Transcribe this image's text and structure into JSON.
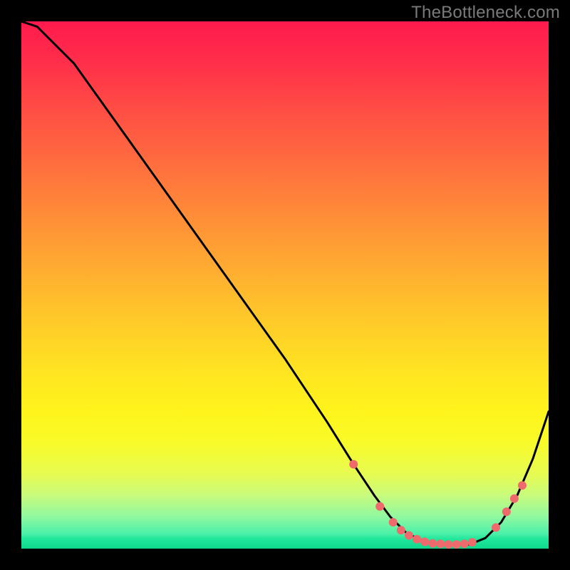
{
  "watermark": "TheBottleneck.com",
  "chart_data": {
    "type": "line",
    "title": "",
    "xlabel": "",
    "ylabel": "",
    "xlim": [
      0,
      100
    ],
    "ylim": [
      0,
      100
    ],
    "series": [
      {
        "name": "bottleneck-curve",
        "x": [
          0,
          3,
          10,
          20,
          30,
          40,
          50,
          58,
          63,
          67,
          70,
          73,
          76,
          79,
          82,
          85,
          88,
          91,
          94,
          97,
          100
        ],
        "y": [
          100,
          99,
          92,
          78,
          64,
          50,
          36,
          24,
          16,
          10,
          6,
          3,
          1.5,
          0.8,
          0.7,
          0.8,
          2,
          5,
          10,
          17,
          26
        ]
      }
    ],
    "markers": {
      "name": "highlight-points",
      "color": "#ef6a6d",
      "points": [
        {
          "x": 63,
          "y": 16
        },
        {
          "x": 68,
          "y": 8
        },
        {
          "x": 70.5,
          "y": 5
        },
        {
          "x": 72,
          "y": 3.5
        },
        {
          "x": 73.5,
          "y": 2.5
        },
        {
          "x": 75,
          "y": 1.8
        },
        {
          "x": 76.5,
          "y": 1.3
        },
        {
          "x": 78,
          "y": 1.0
        },
        {
          "x": 79.5,
          "y": 0.9
        },
        {
          "x": 81,
          "y": 0.8
        },
        {
          "x": 82.5,
          "y": 0.8
        },
        {
          "x": 84,
          "y": 0.9
        },
        {
          "x": 85.5,
          "y": 1.2
        },
        {
          "x": 90,
          "y": 4
        },
        {
          "x": 92,
          "y": 7
        },
        {
          "x": 93.5,
          "y": 9.5
        },
        {
          "x": 95,
          "y": 12
        }
      ]
    },
    "background": {
      "type": "vertical-gradient",
      "stops": [
        {
          "pos": 0.0,
          "color": "#ff1a4d"
        },
        {
          "pos": 0.5,
          "color": "#ffc82a"
        },
        {
          "pos": 0.8,
          "color": "#f8fb2a"
        },
        {
          "pos": 1.0,
          "color": "#17e39a"
        }
      ]
    }
  }
}
